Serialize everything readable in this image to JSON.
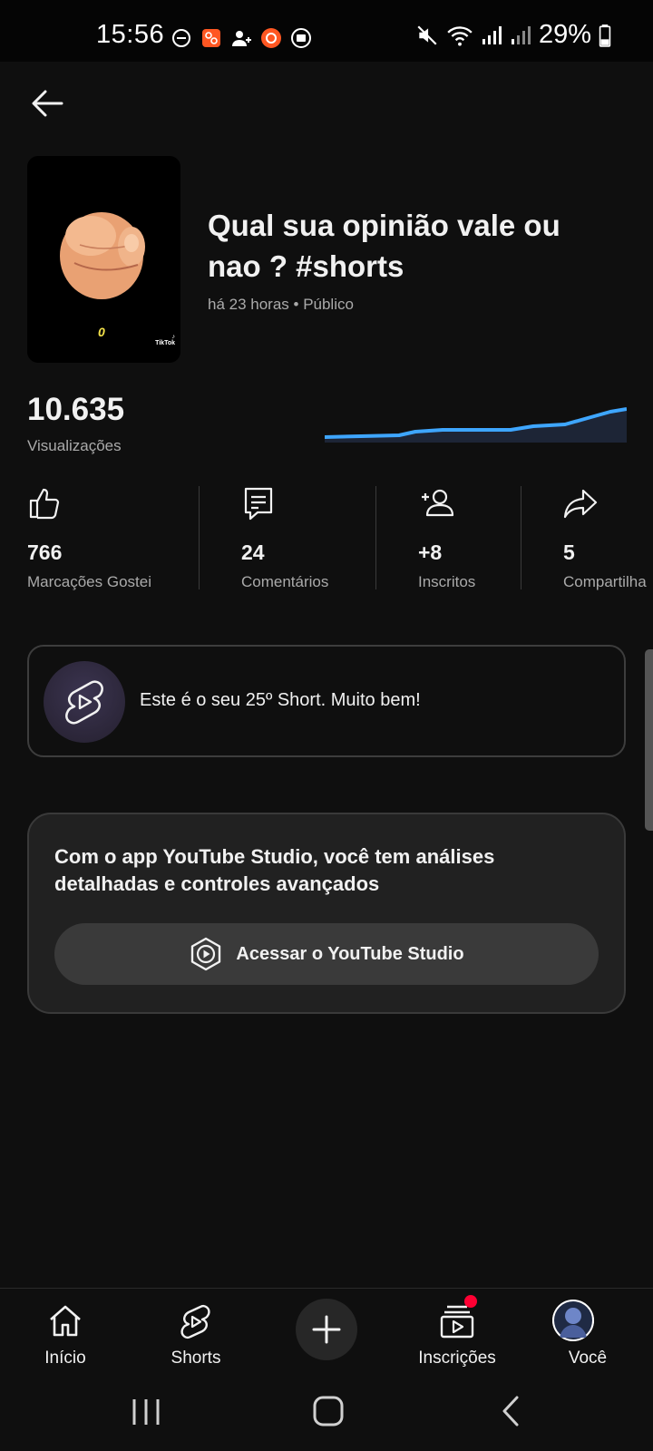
{
  "status_bar": {
    "time": "15:56",
    "battery": "29%"
  },
  "video": {
    "title": "Qual sua opinião vale ou nao ? #shorts",
    "meta": "há 23 horas • Público",
    "thumbnail_number": "0",
    "thumbnail_brand": "TikTok"
  },
  "views": {
    "count": "10.635",
    "label": "Visualizações"
  },
  "stats": [
    {
      "value": "766",
      "label": "Marcações Gostei",
      "icon": "thumbs-up-icon"
    },
    {
      "value": "24",
      "label": "Comentários",
      "icon": "comment-icon"
    },
    {
      "value": "+8",
      "label": "Inscritos",
      "icon": "add-person-icon"
    },
    {
      "value": "5",
      "label": "Compartilha",
      "icon": "share-icon"
    }
  ],
  "milestone": {
    "text": "Este é o seu 25º Short. Muito bem!"
  },
  "studio": {
    "text": "Com o app YouTube Studio, você tem análises detalhadas e controles avançados",
    "button_label": "Acessar o YouTube Studio"
  },
  "bottom_nav": {
    "home": "Início",
    "shorts": "Shorts",
    "subscriptions": "Inscrições",
    "you": "Você"
  },
  "colors": {
    "background": "#0f0f0f",
    "sparkline": "#3ea6ff",
    "notification": "#ff0033"
  }
}
